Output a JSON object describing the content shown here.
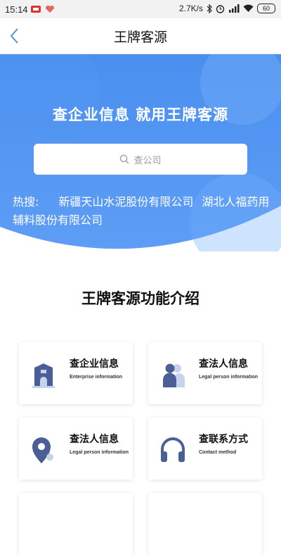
{
  "status_bar": {
    "time": "15:14",
    "speed": "2.7K/s",
    "battery": "60",
    "icons": [
      "app-icon",
      "heart-icon",
      "bluetooth-icon",
      "alarm-icon",
      "signal-icon",
      "wifi-icon",
      "battery-icon"
    ]
  },
  "nav": {
    "title": "王牌客源",
    "back_icon": "back-chevron-icon"
  },
  "hero": {
    "slogan": "查企业信息 就用王牌客源",
    "search_placeholder": "查公司",
    "hot_label": "热搜:",
    "hot_items": [
      "新疆天山水泥股份有限公司",
      "湖北人福药用辅料股份有限公司"
    ],
    "colors": {
      "top": "#4a8ff0",
      "bottom": "#5d9df5",
      "circle": "#73aef8"
    }
  },
  "features": {
    "title": "王牌客源功能介绍",
    "cards": [
      {
        "title": "查企业信息",
        "subtitle": "Enterprise information",
        "icon": "building-icon"
      },
      {
        "title": "查法人信息",
        "subtitle": "Legal person information",
        "icon": "person-icon"
      },
      {
        "title": "查法人信息",
        "subtitle": "Legal person information",
        "icon": "location-pin-icon"
      },
      {
        "title": "查联系方式",
        "subtitle": "Contact method",
        "icon": "headphones-icon"
      }
    ],
    "colors": {
      "icon_dark": "#4a5f95",
      "icon_light": "#c5d3ee"
    }
  }
}
